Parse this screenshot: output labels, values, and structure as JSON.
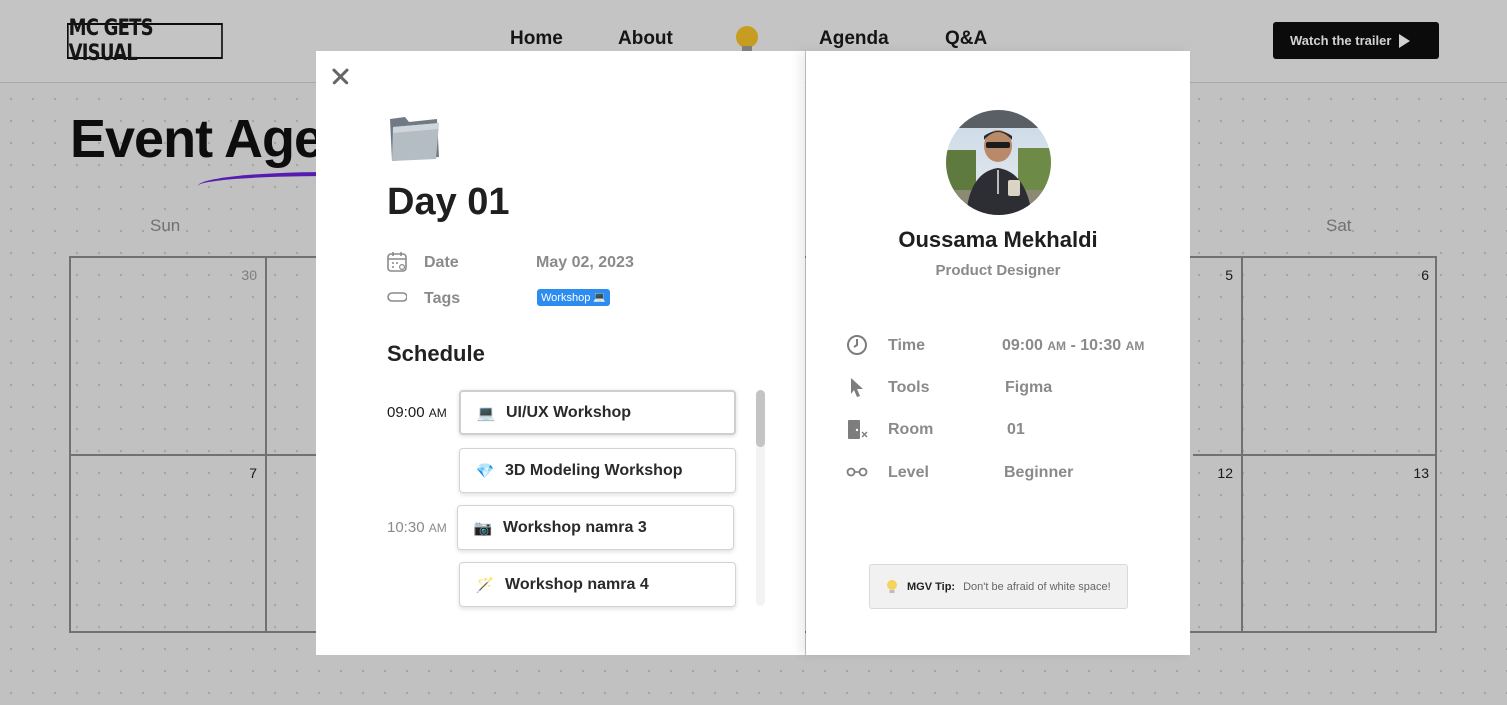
{
  "header": {
    "logo": "MC GETS VISUAL",
    "nav": [
      "Home",
      "About",
      "Agenda",
      "Q&A"
    ],
    "trailer_button": "Watch the trailer"
  },
  "page": {
    "title": "Event Age",
    "days_of_week": [
      "Sun",
      "Sat"
    ],
    "calendar_numbers": {
      "row1": [
        "30",
        "5",
        "6"
      ],
      "row2": [
        "7",
        "12",
        "13"
      ]
    }
  },
  "modal": {
    "day_title": "Day 01",
    "date_label": "Date",
    "date_value": "May 02, 2023",
    "tags_label": "Tags",
    "tag": "Workshop",
    "schedule_title": "Schedule",
    "schedule": [
      {
        "time": "09:00",
        "ampm": "AM",
        "title": "UI/UX Workshop",
        "emoji": "💻"
      },
      {
        "time": "",
        "ampm": "",
        "title": "3D Modeling Workshop",
        "emoji": "💎"
      },
      {
        "time": "10:30",
        "ampm": "AM",
        "title": "Workshop namra 3",
        "emoji": "📷"
      },
      {
        "time": "",
        "ampm": "",
        "title": "Workshop namra 4",
        "emoji": "🪄"
      }
    ]
  },
  "speaker": {
    "name": "Oussama Mekhaldi",
    "role": "Product Designer",
    "time_label": "Time",
    "time_start": "09:00",
    "time_start_ampm": "AM",
    "time_sep": "-",
    "time_end": "10:30",
    "time_end_ampm": "AM",
    "tools_label": "Tools",
    "tools_value": "Figma",
    "room_label": "Room",
    "room_value": "01",
    "level_label": "Level",
    "level_value": "Beginner"
  },
  "tip": {
    "label": "MGV Tip:",
    "text": "Don't be afraid of white space!"
  },
  "colors": {
    "accent_purple": "#6a23d9",
    "tag_blue": "#2d8cf0",
    "bulb_yellow": "#f2c029"
  }
}
